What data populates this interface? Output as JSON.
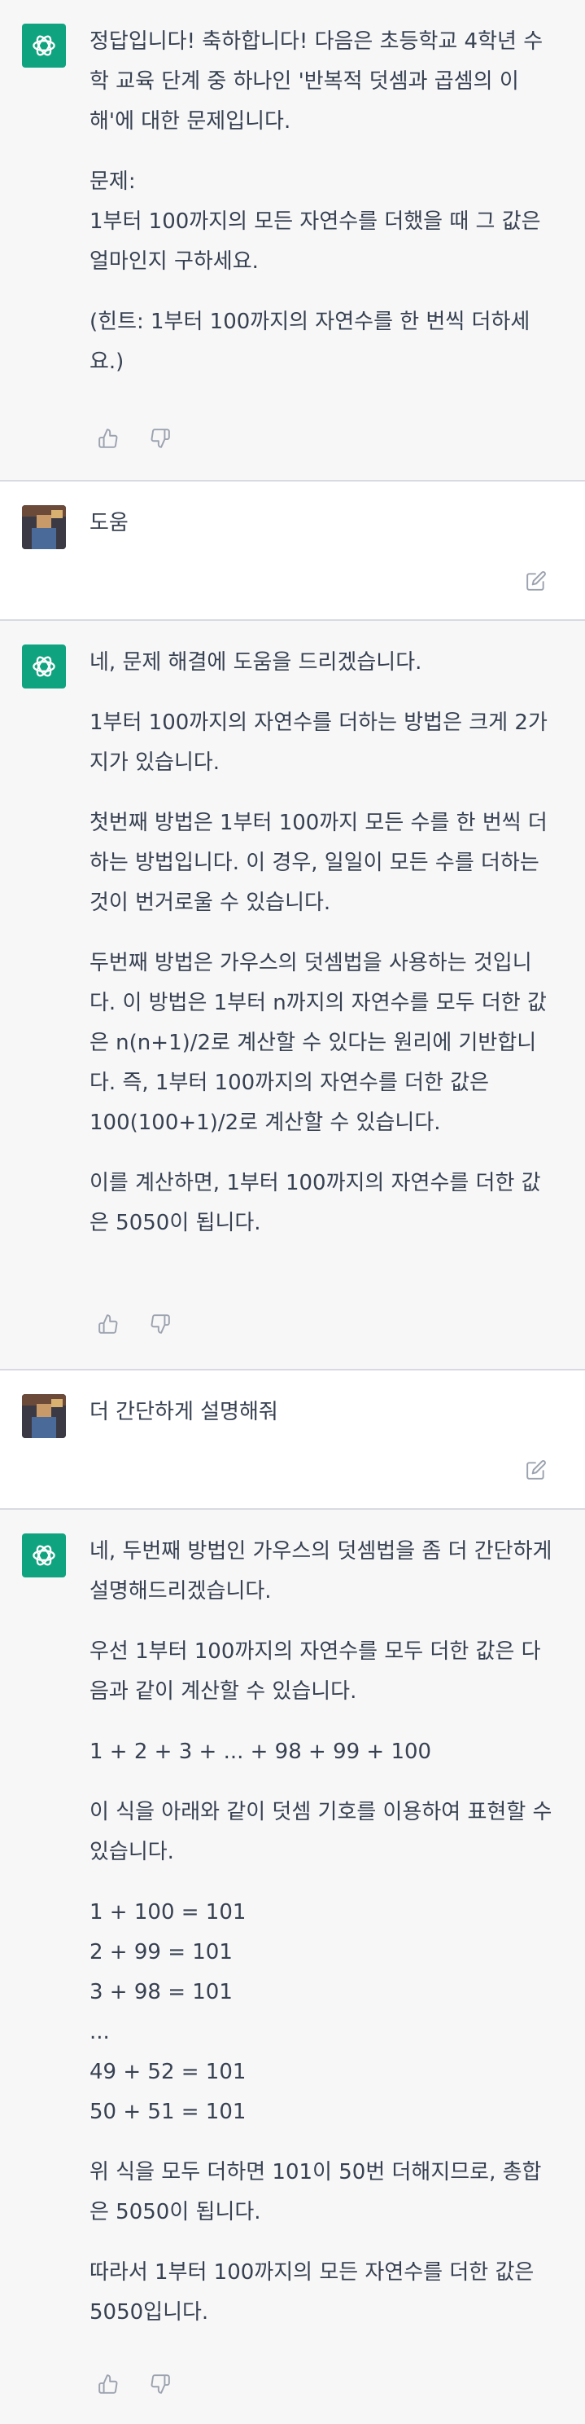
{
  "messages": [
    {
      "role": "assistant",
      "paragraphs": [
        "정답입니다! 축하합니다! 다음은 초등학교 4학년 수학 교육 단계 중 하나인 '반복적 덧셈과 곱셈의 이해'에 대한 문제입니다.",
        "문제:\n1부터 100까지의 모든 자연수를 더했을 때 그 값은 얼마인지 구하세요.",
        "(힌트: 1부터 100까지의 자연수를 한 번씩 더하세요.)"
      ]
    },
    {
      "role": "user",
      "text": "도움"
    },
    {
      "role": "assistant",
      "paragraphs": [
        "네, 문제 해결에 도움을 드리겠습니다.",
        "1부터 100까지의 자연수를 더하는 방법은 크게 2가지가 있습니다.",
        "첫번째 방법은 1부터 100까지 모든 수를 한 번씩 더하는 방법입니다. 이 경우, 일일이 모든 수를 더하는 것이 번거로울 수 있습니다.",
        "두번째 방법은 가우스의 덧셈법을 사용하는 것입니다. 이 방법은 1부터 n까지의 자연수를 모두 더한 값은 n(n+1)/2로 계산할 수 있다는 원리에 기반합니다. 즉, 1부터 100까지의 자연수를 더한 값은 100(100+1)/2로 계산할 수 있습니다.",
        "이를 계산하면, 1부터 100까지의 자연수를 더한 값은 5050이 됩니다."
      ]
    },
    {
      "role": "user",
      "text": "더 간단하게 설명해줘"
    },
    {
      "role": "assistant",
      "paragraphs": [
        "네, 두번째 방법인 가우스의 덧셈법을 좀 더 간단하게 설명해드리겠습니다.",
        "우선 1부터 100까지의 자연수를 모두 더한 값은 다음과 같이 계산할 수 있습니다.",
        "1 + 2 + 3 + ... + 98 + 99 + 100",
        "이 식을 아래와 같이 덧셈 기호를 이용하여 표현할 수 있습니다.",
        "1 + 100 = 101\n2 + 99 = 101\n3 + 98 = 101\n...\n49 + 52 = 101\n50 + 51 = 101",
        "위 식을 모두 더하면 101이 50번 더해지므로, 총합은 5050이 됩니다.",
        "따라서 1부터 100까지의 모든 자연수를 더한 값은 5050입니다."
      ]
    }
  ],
  "icons": {
    "assistant_avatar": "openai-logo-icon",
    "thumbs_up": "thumbs-up-icon",
    "thumbs_down": "thumbs-down-icon",
    "edit": "edit-icon"
  },
  "colors": {
    "assistant_bg": "#f7f7f8",
    "user_bg": "#ffffff",
    "avatar_green": "#10a37f",
    "text": "#374151",
    "icon_gray": "#9ca3af",
    "divider": "#d9d9e3"
  }
}
